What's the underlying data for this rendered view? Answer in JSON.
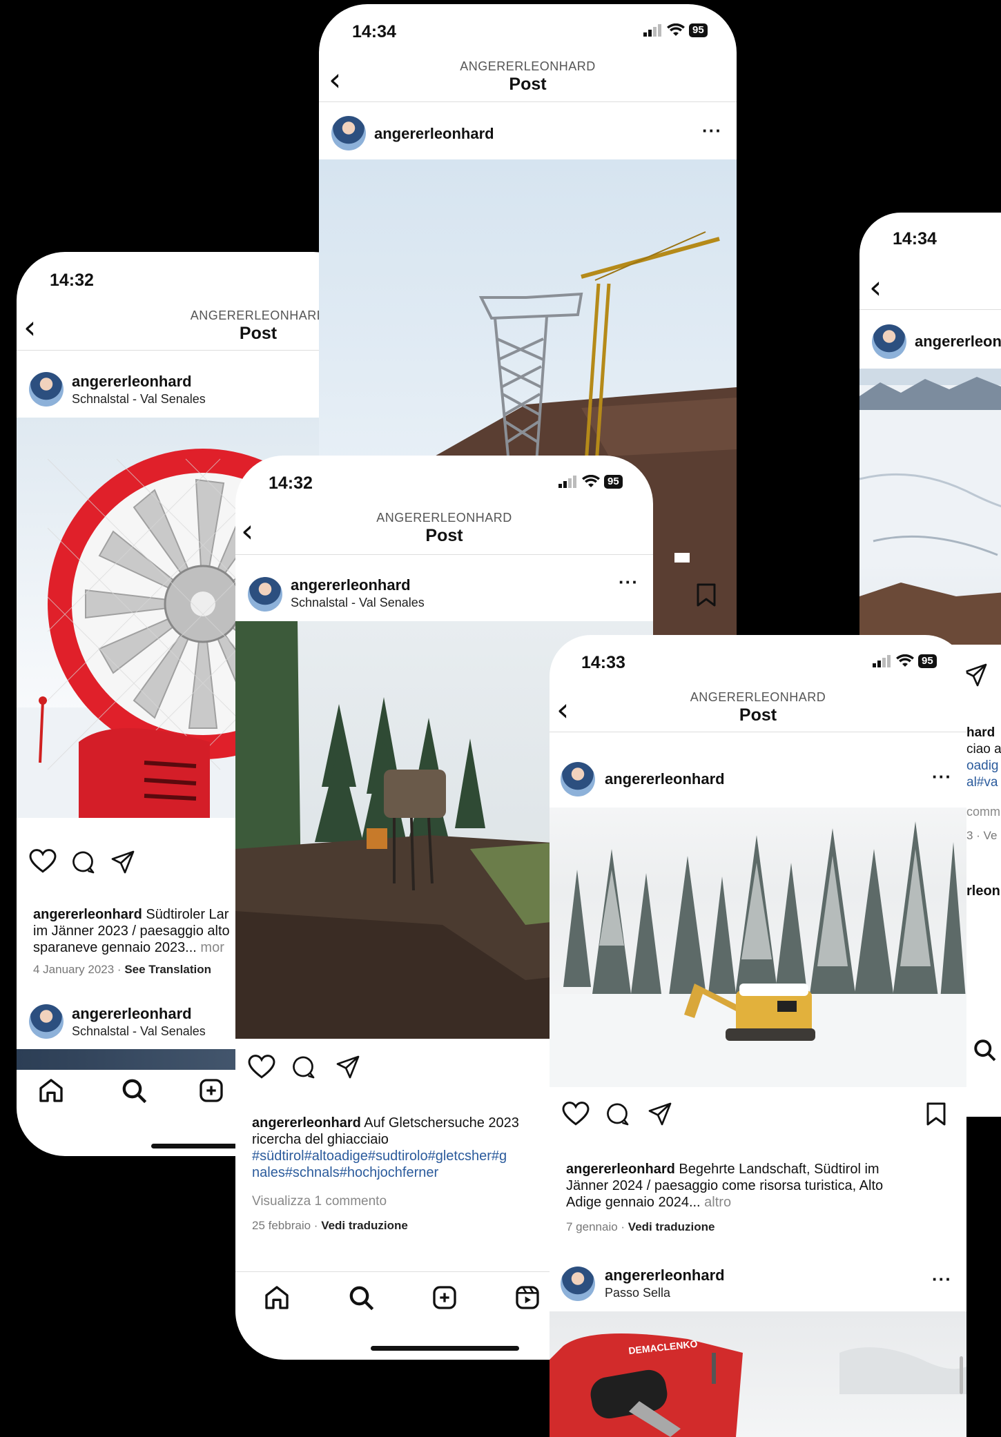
{
  "phone_back_left": {
    "time": "14:32",
    "header_user": "ANGERERLEONHARD",
    "header_title": "Post",
    "post": {
      "username": "angererleonhard",
      "location": "Schnalstal - Val Senales"
    },
    "caption_user": "angererleonhard",
    "caption_text_1": "Südtiroler Lar",
    "caption_text_2": "im Jänner 2023 / paesaggio alto",
    "caption_text_3": "sparaneve gennaio 2023...",
    "caption_more": "mor",
    "date": "4 January 2023",
    "translation": "See Translation",
    "next_post": {
      "username": "angererleonhard",
      "location": "Schnalstal - Val Senales"
    }
  },
  "phone_top_center": {
    "time": "14:34",
    "battery": "95",
    "header_user": "ANGERERLEONHARD",
    "header_title": "Post",
    "post": {
      "username": "angererleonhard"
    }
  },
  "phone_right": {
    "time": "14:34",
    "post_username": "angererleon",
    "caption_fragments": [
      "hard",
      "ciao a",
      "oadig",
      "al#va"
    ],
    "comments_fragment": "comm",
    "date_fragment": "3 · Ve",
    "next_post_fragment": "rleon"
  },
  "phone_mid": {
    "time": "14:32",
    "battery": "95",
    "header_user": "ANGERERLEONHARD",
    "header_title": "Post",
    "post": {
      "username": "angererleonhard",
      "location": "Schnalstal - Val Senales"
    },
    "caption_user": "angererleonhard",
    "caption_text": "Auf Gletschersuche 2023",
    "caption_text_2": "ricercha del ghiacciaio",
    "hashtags_1": "#südtirol#altoadige#sudtirolo#gletcsher#g",
    "hashtags_2": "nales#schnals#hochjochferner",
    "view_comments": "Visualizza 1 commento",
    "date": "25 febbraio",
    "translation": "Vedi traduzione"
  },
  "phone_front": {
    "time": "14:33",
    "battery": "95",
    "header_user": "ANGERERLEONHARD",
    "header_title": "Post",
    "post": {
      "username": "angererleonhard"
    },
    "caption_user": "angererleonhard",
    "caption_line_1": "Begehrte Landschaft, Südtirol im",
    "caption_line_2": "Jänner 2024 / paesaggio come risorsa turistica, Alto",
    "caption_line_3": "Adige gennaio 2024...",
    "caption_more": "altro",
    "date": "7 gennaio",
    "translation": "Vedi traduzione",
    "next_post": {
      "username": "angererleonhard",
      "location": "Passo Sella"
    },
    "next_photo_brand": "DEMACLENKO"
  }
}
